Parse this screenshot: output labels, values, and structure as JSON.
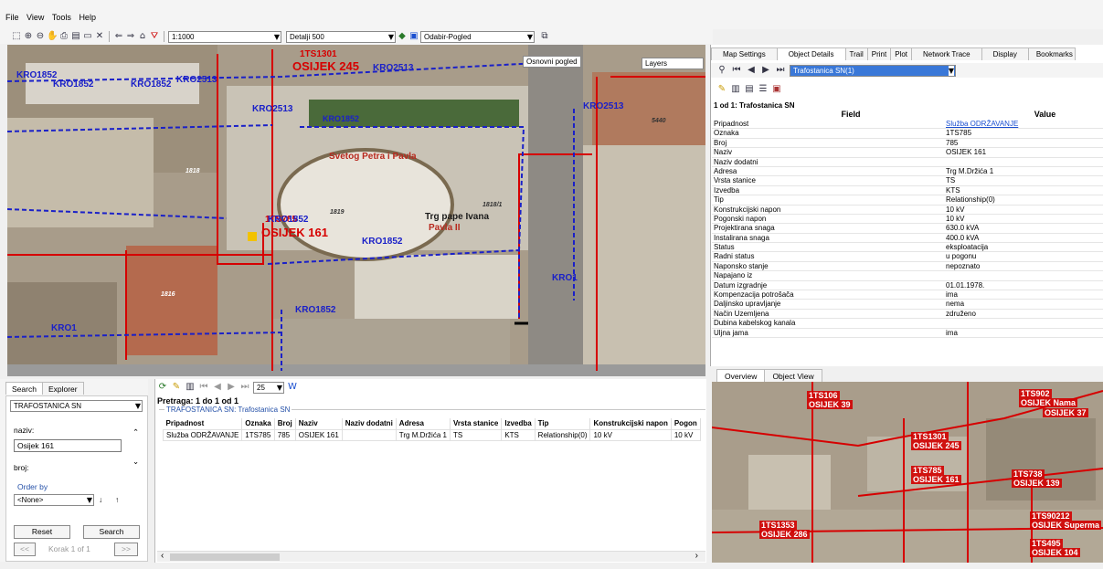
{
  "menu": [
    "File",
    "View",
    "Tools",
    "Help"
  ],
  "toolbar": {
    "scale": "1:1000",
    "detail": "Detalji 500",
    "view": "Odabir-Pogled",
    "icons": [
      "select-icon",
      "zoom-in-icon",
      "zoom-out-icon",
      "pan-icon",
      "print-icon",
      "print-preview-icon",
      "rectangle-icon",
      "clear-icon",
      "back-icon",
      "forward-icon",
      "home-icon",
      "filter-icon"
    ]
  },
  "map": {
    "tooltip": "Osnovni pogled",
    "layers_label": "Layers",
    "labels": {
      "osijek245": "OSIJEK 245",
      "osijek161": "OSIJEK 161",
      "kro1852": "KRO1852",
      "kro2513": "KRO2513",
      "kro1": "KRO1",
      "ts785": "1TS785",
      "ts1301": "1TS1301",
      "church": "Svetog Petra i Pavla",
      "square1": "Trg pape Ivana",
      "square2": "Pavla II",
      "parcel1818": "1818",
      "parcel1819": "1819",
      "parcel18181": "1818/1",
      "parcel1816": "1816",
      "parcel5440": "5440"
    }
  },
  "right_panel": {
    "tabs": [
      "Map Settings",
      "Object Details",
      "Trail",
      "Print",
      "Plot",
      "Network Trace",
      "Display",
      "Bookmarks"
    ],
    "active_tab": "Object Details",
    "selector": "Trafostanica SN(1)",
    "heading": "1 od 1: Trafostanica SN",
    "col_field": "Field",
    "col_value": "Value",
    "rows": [
      {
        "f": "Pripadnost",
        "v": "Služba ODRŽAVANJE"
      },
      {
        "f": "Oznaka",
        "v": "1TS785"
      },
      {
        "f": "Broj",
        "v": "785"
      },
      {
        "f": "Naziv",
        "v": "OSIJEK 161"
      },
      {
        "f": "Naziv dodatni",
        "v": ""
      },
      {
        "f": "Adresa",
        "v": "Trg M.Držića 1"
      },
      {
        "f": "Vrsta stanice",
        "v": "TS"
      },
      {
        "f": "Izvedba",
        "v": "KTS"
      },
      {
        "f": "Tip",
        "v": "Relationship(0)"
      },
      {
        "f": "Konstrukcijski napon",
        "v": "10 kV"
      },
      {
        "f": "Pogonski napon",
        "v": "10 kV"
      },
      {
        "f": "Projektirana snaga",
        "v": "630.0 kVA"
      },
      {
        "f": "Instalirana snaga",
        "v": "400.0 kVA"
      },
      {
        "f": "Status",
        "v": "eksploatacija"
      },
      {
        "f": "Radni status",
        "v": "u pogonu"
      },
      {
        "f": "Naponsko stanje",
        "v": "nepoznato"
      },
      {
        "f": "Napajano iz",
        "v": ""
      },
      {
        "f": "Datum izgradnje",
        "v": "01.01.1978."
      },
      {
        "f": "Kompenzacija potrošača",
        "v": "ima"
      },
      {
        "f": "Daljinsko upravljanje",
        "v": "nema"
      },
      {
        "f": "Način Uzemljena",
        "v": "združeno"
      },
      {
        "f": "Dubina kabelskog kanala",
        "v": ""
      },
      {
        "f": "Uljna jama",
        "v": "ima"
      }
    ]
  },
  "overview": {
    "tabs": [
      "Overview",
      "Object View"
    ],
    "active_tab": "Overview",
    "labels": {
      "l1": "1TS106",
      "l2": "OSIJEK 39",
      "l3": "1TS902",
      "l4": "OSIJEK Nama",
      "l5": "OSIJEK 37",
      "l6": "1TS1301",
      "l7": "OSIJEK 245",
      "l8": "1TS785",
      "l9": "OSIJEK 161",
      "l10": "1TS738",
      "l11": "OSIJEK 139",
      "l12": "1TS1353",
      "l13": "OSIJEK 286",
      "l14": "1TS90212",
      "l15": "OSIJEK Superma",
      "l16": "1TS495",
      "l17": "OSIJEK 104"
    }
  },
  "search_panel": {
    "tabs": [
      "Search",
      "Explorer"
    ],
    "active_tab": "Search",
    "layer": "TRAFOSTANICA SN",
    "field1_label": "naziv:",
    "field1_value": "Osijek 161",
    "field2_label": "broj:",
    "order_label": "Order by",
    "order_value": "<None>",
    "reset": "Reset",
    "search": "Search",
    "prev": "<<",
    "next": ">>",
    "page": "Korak 1 of 1"
  },
  "results": {
    "page_size": "25",
    "title": "Pretraga: 1 do 1 od 1",
    "group": "TRAFOSTANICA SN: Trafostanica SN",
    "columns": [
      "Pripadnost",
      "Oznaka",
      "Broj",
      "Naziv",
      "Naziv dodatni",
      "Adresa",
      "Vrsta stanice",
      "Izvedba",
      "Tip",
      "Konstrukcijski napon",
      "Pogon"
    ],
    "rows": [
      [
        "Služba ODRŽAVANJE",
        "1TS785",
        "785",
        "OSIJEK 161",
        "",
        "Trg M.Držića 1",
        "TS",
        "KTS",
        "Relationship(0)",
        "10 kV",
        "10 kV"
      ]
    ]
  },
  "colors": {
    "network_blue": "#1a20c8",
    "network_red": "#d60000",
    "link": "#1a4fd0"
  }
}
